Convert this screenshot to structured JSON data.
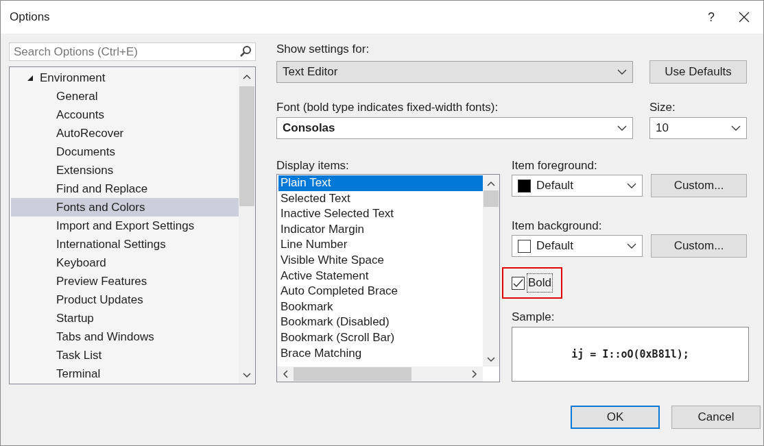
{
  "window": {
    "title": "Options",
    "help": "?"
  },
  "search": {
    "placeholder": "Search Options (Ctrl+E)"
  },
  "tree": [
    {
      "label": "Environment",
      "expanded": true,
      "selected": false,
      "children": [
        {
          "label": "General",
          "selected": false
        },
        {
          "label": "Accounts",
          "selected": false
        },
        {
          "label": "AutoRecover",
          "selected": false
        },
        {
          "label": "Documents",
          "selected": false
        },
        {
          "label": "Extensions",
          "selected": false
        },
        {
          "label": "Find and Replace",
          "selected": false
        },
        {
          "label": "Fonts and Colors",
          "selected": true
        },
        {
          "label": "Import and Export Settings",
          "selected": false
        },
        {
          "label": "International Settings",
          "selected": false
        },
        {
          "label": "Keyboard",
          "selected": false
        },
        {
          "label": "Preview Features",
          "selected": false
        },
        {
          "label": "Product Updates",
          "selected": false
        },
        {
          "label": "Startup",
          "selected": false
        },
        {
          "label": "Tabs and Windows",
          "selected": false
        },
        {
          "label": "Task List",
          "selected": false
        },
        {
          "label": "Terminal",
          "selected": false
        }
      ]
    }
  ],
  "show_settings": {
    "label": "Show settings for:",
    "value": "Text Editor"
  },
  "use_defaults": "Use Defaults",
  "font": {
    "label": "Font (bold type indicates fixed-width fonts):",
    "value": "Consolas"
  },
  "size": {
    "label": "Size:",
    "value": "10"
  },
  "display_items": {
    "label": "Display items:",
    "items": [
      {
        "label": "Plain Text",
        "selected": true
      },
      {
        "label": "Selected Text",
        "selected": false
      },
      {
        "label": "Inactive Selected Text",
        "selected": false
      },
      {
        "label": "Indicator Margin",
        "selected": false
      },
      {
        "label": "Line Number",
        "selected": false
      },
      {
        "label": "Visible White Space",
        "selected": false
      },
      {
        "label": "Active Statement",
        "selected": false
      },
      {
        "label": "Auto Completed Brace",
        "selected": false
      },
      {
        "label": "Bookmark",
        "selected": false
      },
      {
        "label": "Bookmark (Disabled)",
        "selected": false
      },
      {
        "label": "Bookmark (Scroll Bar)",
        "selected": false
      },
      {
        "label": "Brace Matching",
        "selected": false
      }
    ]
  },
  "foreground": {
    "label": "Item foreground:",
    "value": "Default",
    "color": "#000000",
    "button": "Custom..."
  },
  "background": {
    "label": "Item background:",
    "value": "Default",
    "color": "#ffffff",
    "button": "Custom..."
  },
  "bold": {
    "label": "Bold",
    "checked": true,
    "highlighted": true
  },
  "sample": {
    "label": "Sample:",
    "text": "ij = I::oO(0xB81l);"
  },
  "buttons": [
    {
      "label": "OK",
      "default": true
    },
    {
      "label": "Cancel",
      "default": false
    }
  ]
}
